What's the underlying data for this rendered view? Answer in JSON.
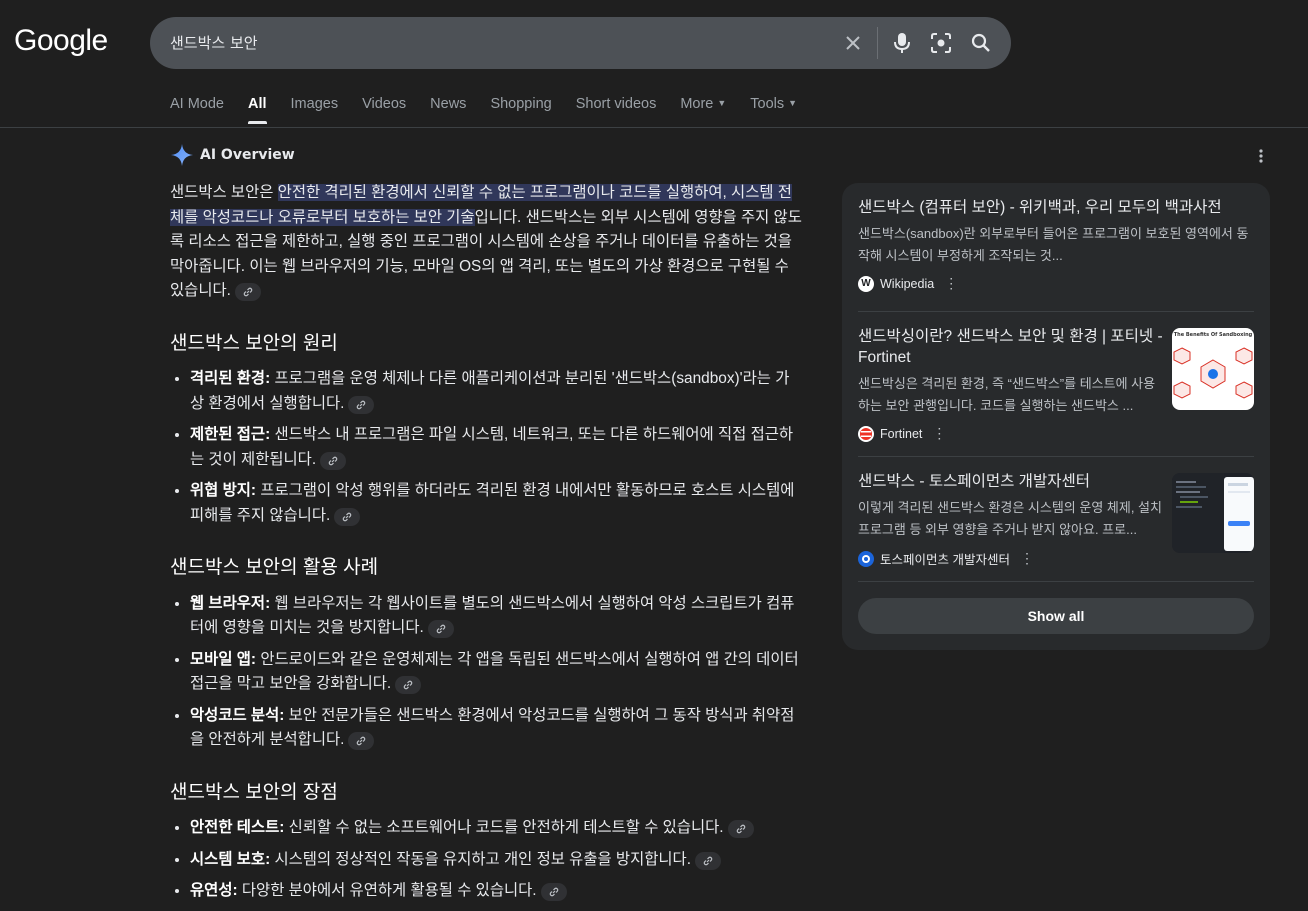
{
  "logo": "Google",
  "search": {
    "query": "샌드박스 보안"
  },
  "tabs": [
    {
      "label": "AI Mode"
    },
    {
      "label": "All"
    },
    {
      "label": "Images"
    },
    {
      "label": "Videos"
    },
    {
      "label": "News"
    },
    {
      "label": "Shopping"
    },
    {
      "label": "Short videos"
    },
    {
      "label": "More"
    },
    {
      "label": "Tools"
    }
  ],
  "ai_overview": {
    "title": "AI Overview",
    "intro_prefix": "샌드박스 보안은 ",
    "intro_highlight": "안전한 격리된 환경에서 신뢰할 수 없는 프로그램이나 코드를 실행하여, 시스템 전체를 악성코드나 오류로부터 보호하는 보안 기술",
    "intro_suffix": "입니다. 샌드박스는 외부 시스템에 영향을 주지 않도록 리소스 접근을 제한하고, 실행 중인 프로그램이 시스템에 손상을 주거나 데이터를 유출하는 것을 막아줍니다. 이는 웹 브라우저의 기능, 모바일 OS의 앱 격리, 또는 별도의 가상 환경으로 구현될 수 있습니다.",
    "sections": [
      {
        "heading": "샌드박스 보안의 원리",
        "items": [
          {
            "term": "격리된 환경:",
            "text": " 프로그램을 운영 체제나 다른 애플리케이션과 분리된 '샌드박스(sandbox)'라는 가상 환경에서 실행합니다."
          },
          {
            "term": "제한된 접근:",
            "text": " 샌드박스 내 프로그램은 파일 시스템, 네트워크, 또는 다른 하드웨어에 직접 접근하는 것이 제한됩니다."
          },
          {
            "term": "위협 방지:",
            "text": " 프로그램이 악성 행위를 하더라도 격리된 환경 내에서만 활동하므로 호스트 시스템에 피해를 주지 않습니다."
          }
        ]
      },
      {
        "heading": "샌드박스 보안의 활용 사례",
        "items": [
          {
            "term": "웹 브라우저:",
            "text": " 웹 브라우저는 각 웹사이트를 별도의 샌드박스에서 실행하여 악성 스크립트가 컴퓨터에 영향을 미치는 것을 방지합니다."
          },
          {
            "term": "모바일 앱:",
            "text": " 안드로이드와 같은 운영체제는 각 앱을 독립된 샌드박스에서 실행하여 앱 간의 데이터 접근을 막고 보안을 강화합니다."
          },
          {
            "term": "악성코드 분석:",
            "text": " 보안 전문가들은 샌드박스 환경에서 악성코드를 실행하여 그 동작 방식과 취약점을 안전하게 분석합니다."
          }
        ]
      },
      {
        "heading": "샌드박스 보안의 장점",
        "items": [
          {
            "term": "안전한 테스트:",
            "text": " 신뢰할 수 없는 소프트웨어나 코드를 안전하게 테스트할 수 있습니다."
          },
          {
            "term": "시스템 보호:",
            "text": " 시스템의 정상적인 작동을 유지하고 개인 정보 유출을 방지합니다."
          },
          {
            "term": "유연성:",
            "text": " 다양한 분야에서 유연하게 활용될 수 있습니다."
          }
        ]
      }
    ]
  },
  "sources": [
    {
      "title": "샌드박스 (컴퓨터 보안) - 위키백과, 우리 모두의 백과사전",
      "snippet": "샌드박스(sandbox)란 외부로부터 들어온 프로그램이 보호된 영역에서 동작해 시스템이 부정하게 조작되는 것...",
      "source": "Wikipedia",
      "favicon": "W"
    },
    {
      "title": "샌드박싱이란? 샌드박스 보안 및 환경 | 포티넷 - Fortinet",
      "snippet": "샌드박싱은 격리된 환경, 즉 “샌드박스”를 테스트에 사용하는 보안 관행입니다. 코드를 실행하는 샌드박스 ...",
      "source": "Fortinet",
      "thumb_caption": "The Benefits Of Sandboxing"
    },
    {
      "title": "샌드박스 - 토스페이먼츠 개발자센터",
      "snippet": "이렇게 격리된 샌드박스 환경은 시스템의 운영 체제, 설치 프로그램 등 외부 영향을 주거나 받지 않아요. 프로...",
      "source": "토스페이먼츠 개발자센터"
    }
  ],
  "show_all": "Show all"
}
